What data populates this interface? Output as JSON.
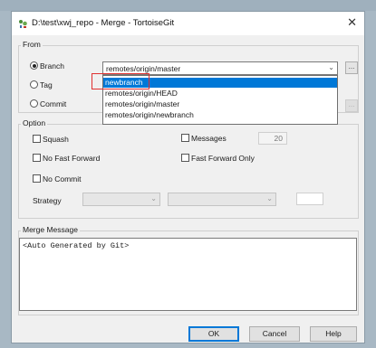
{
  "window": {
    "title": "D:\\test\\xwj_repo - Merge - TortoiseGit",
    "close_glyph": "✕"
  },
  "from": {
    "legend": "From",
    "branch_label": "Branch",
    "tag_label": "Tag",
    "commit_label": "Commit",
    "selected_radio": "branch",
    "branch_value": "remotes/origin/master",
    "browse_glyph": "...",
    "dropdown_items": [
      "newbranch",
      "remotes/origin/HEAD",
      "remotes/origin/master",
      "remotes/origin/newbranch"
    ],
    "highlighted_index": 0
  },
  "option": {
    "legend": "Option",
    "squash_label": "Squash",
    "no_fast_forward_label": "No Fast Forward",
    "no_commit_label": "No Commit",
    "messages_label": "Messages",
    "messages_value": "20",
    "fast_forward_only_label": "Fast Forward Only",
    "strategy_label": "Strategy"
  },
  "merge_message": {
    "legend": "Merge Message",
    "text": "<Auto Generated by Git>"
  },
  "buttons": {
    "ok": "OK",
    "cancel": "Cancel",
    "help": "Help"
  },
  "icons": {
    "app": "tortoisegit-icon",
    "combo_arrow": "⌄"
  }
}
